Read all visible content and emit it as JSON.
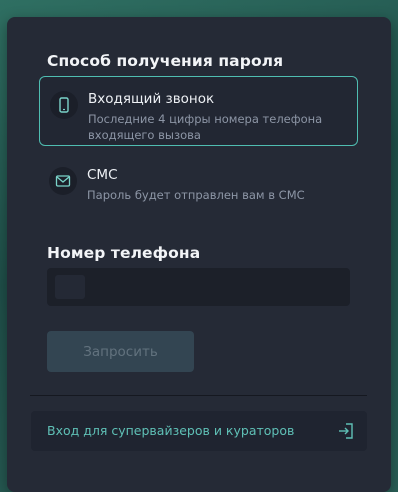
{
  "password_method": {
    "title": "Способ получения пароля",
    "options": [
      {
        "title": "Входящий звонок",
        "description": "Последние 4 цифры номера телефона входящего вызова",
        "icon": "smartphone-icon",
        "selected": true
      },
      {
        "title": "СМС",
        "description": "Пароль будет отправлен вам в СМС",
        "icon": "envelope-icon",
        "selected": false
      }
    ]
  },
  "phone": {
    "title": "Номер телефона",
    "value": "",
    "placeholder": ""
  },
  "request_button": {
    "label": "Запросить",
    "enabled": false
  },
  "supervisor_link": {
    "label": "Вход для супервайзеров и кураторов",
    "icon": "login-icon"
  },
  "colors": {
    "accent": "#4fbdb1",
    "card": "#252a36",
    "link": "#5fc0b6"
  }
}
